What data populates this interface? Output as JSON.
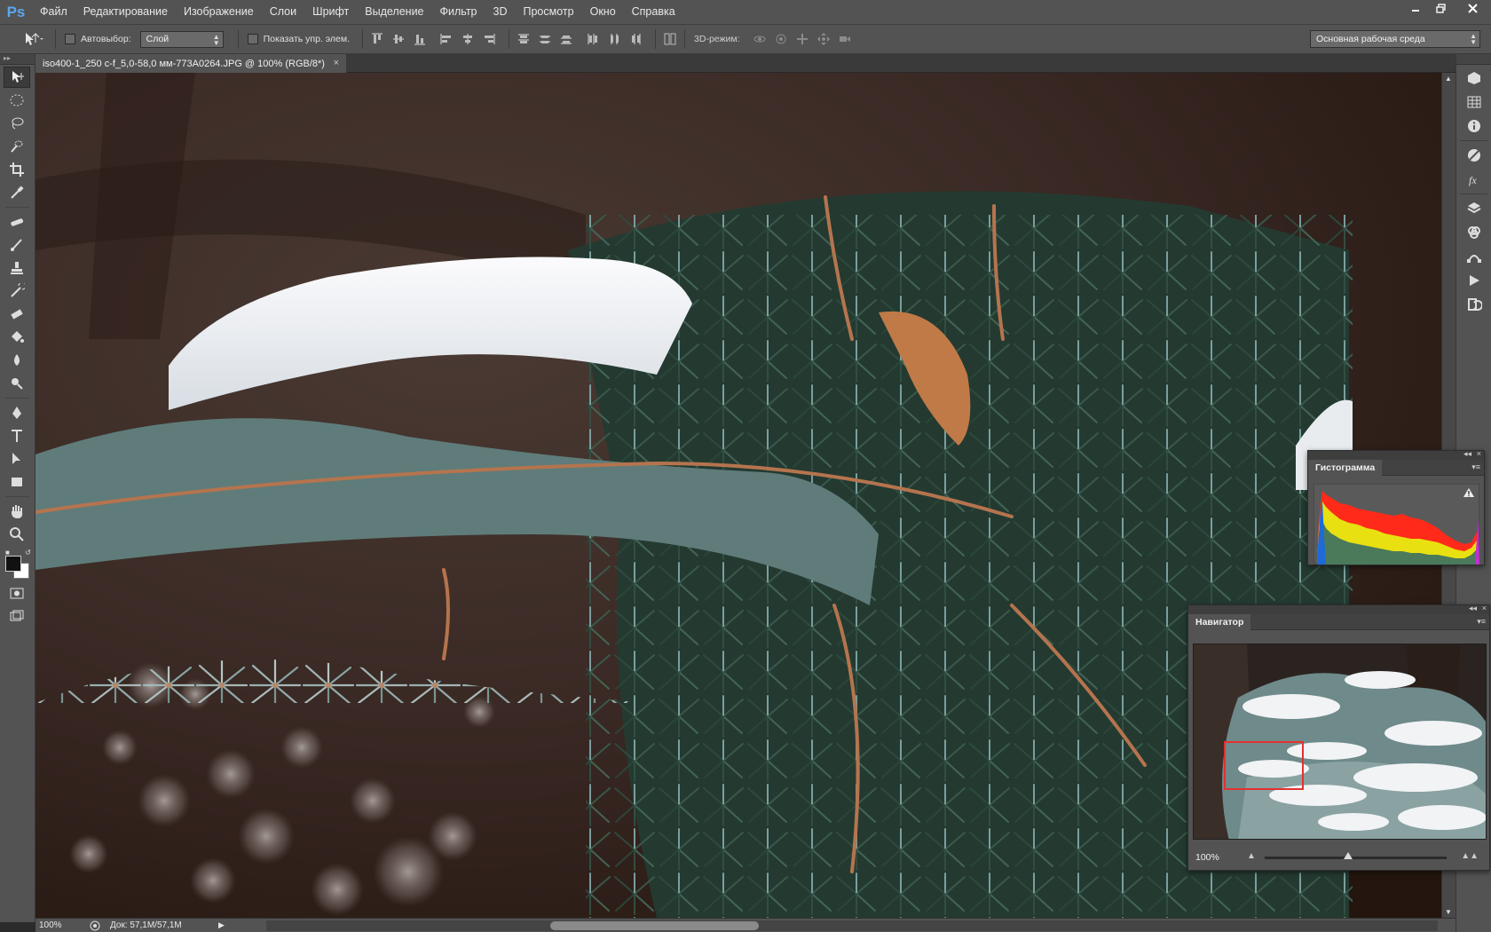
{
  "app": {
    "logo": "Ps",
    "menu": [
      "Файл",
      "Редактирование",
      "Изображение",
      "Слои",
      "Шрифт",
      "Выделение",
      "Фильтр",
      "3D",
      "Просмотр",
      "Окно",
      "Справка"
    ]
  },
  "options": {
    "autoselect_label": "Автовыбор:",
    "autoselect_value": "Слой",
    "show_controls_label": "Показать упр. элем.",
    "mode_3d_label": "3D-режим:",
    "workspace_value": "Основная рабочая среда"
  },
  "document": {
    "tab_title": "iso400-1_250 c-f_5,0-58,0 мм-773A0264.JPG @ 100% (RGB/8*)",
    "tab_close": "×"
  },
  "panels": {
    "histogram": {
      "title": "Гистограмма",
      "warning_icon": "warning-icon"
    },
    "navigator": {
      "title": "Навигатор",
      "zoom": "100%",
      "zoom_slider_fraction": 0.46
    }
  },
  "status": {
    "zoom": "100%",
    "doc_info": "Док: 57,1M/57,1M"
  },
  "colors": {
    "chrome": "#535353",
    "dark_chrome": "#3a3a3a",
    "accent_logo": "#5aa6ee",
    "navigator_frame": "#e53030"
  },
  "tools": [
    "move-tool",
    "marquee-tool",
    "lasso-tool",
    "quick-select-tool",
    "crop-tool",
    "eyedropper-tool",
    "healing-brush-tool",
    "brush-tool",
    "clone-stamp-tool",
    "history-brush-tool",
    "eraser-tool",
    "paint-bucket-tool",
    "blur-tool",
    "dodge-tool",
    "pen-tool",
    "type-tool",
    "path-select-tool",
    "rectangle-tool",
    "hand-tool",
    "zoom-tool"
  ],
  "dock_icons": [
    "3d-panel-icon",
    "grid-panel-icon",
    "info-panel-icon",
    "adjustments-icon",
    "styles-icon",
    "layers-icon",
    "channels-icon",
    "paths-icon",
    "actions-icon",
    "history-icon"
  ]
}
